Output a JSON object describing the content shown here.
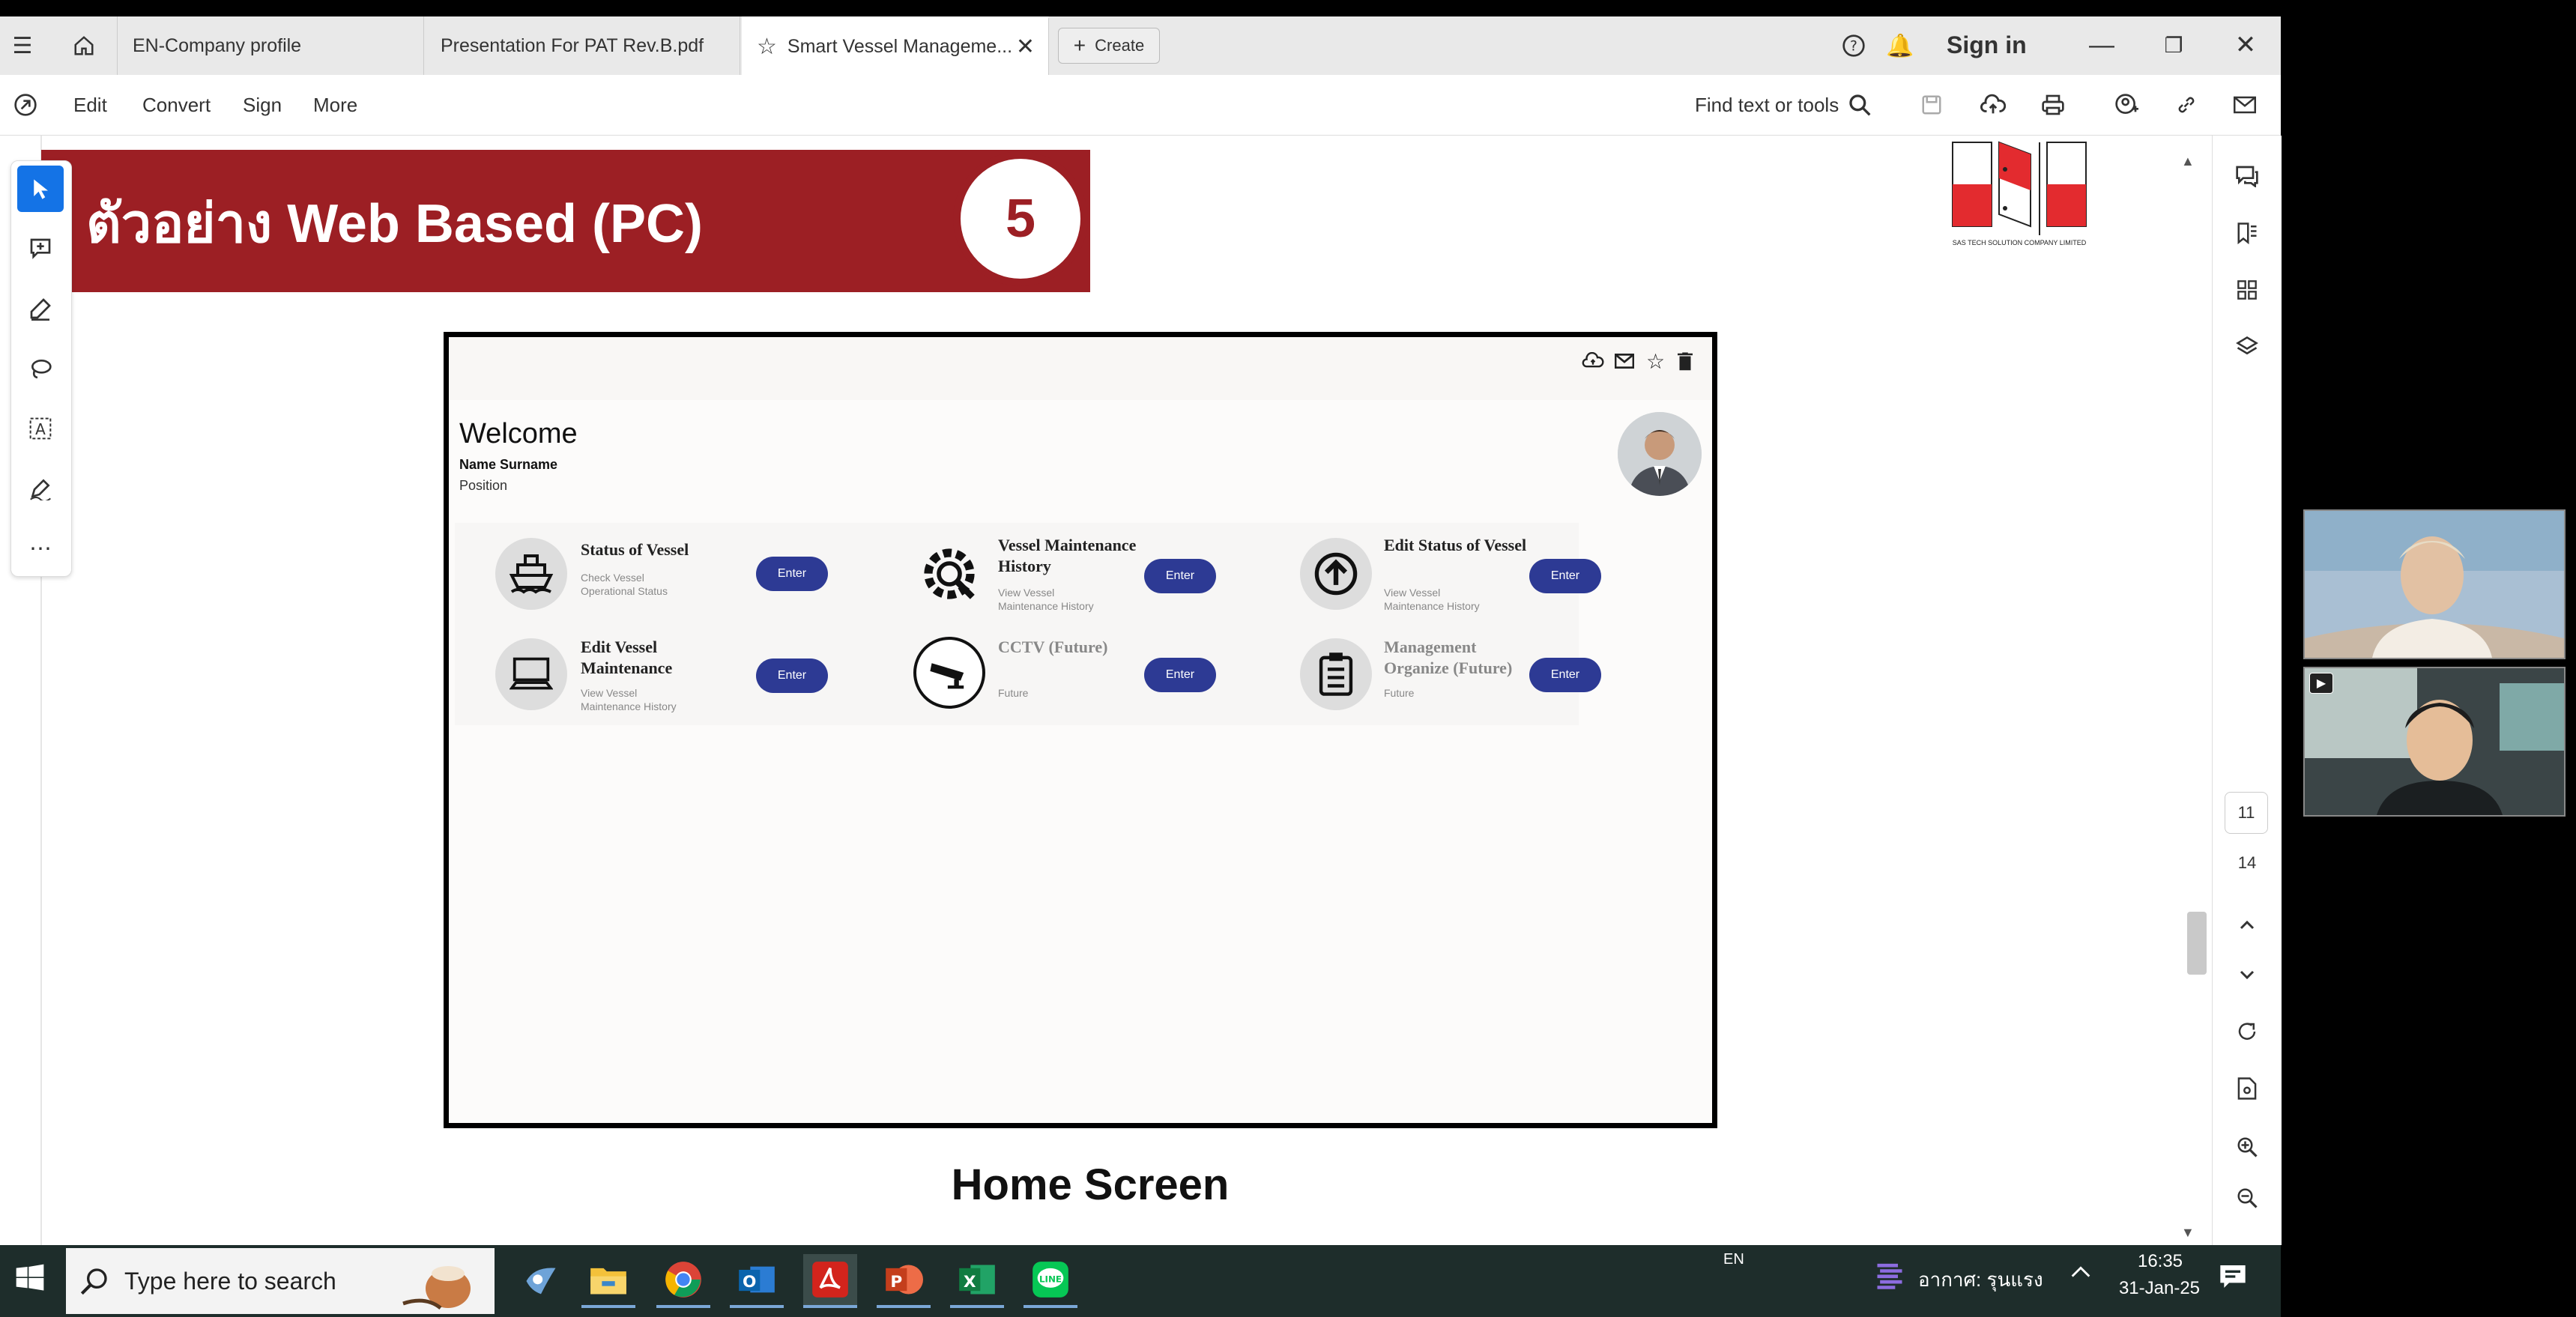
{
  "browser_tabs": [
    {
      "label": "EN-Company profile"
    },
    {
      "label": "Presentation For PAT Rev.B.pdf"
    },
    {
      "label": "Smart Vessel Manageme..."
    }
  ],
  "create_label": "Create",
  "signin_label": "Sign in",
  "menu": {
    "edit": "Edit",
    "convert": "Convert",
    "sign": "Sign",
    "more": "More"
  },
  "find_label": "Find text or tools",
  "page_nav": {
    "current": "11",
    "total": "14"
  },
  "slide": {
    "banner_title": "ตัวอย่าง Web Based (PC)",
    "slide_number": "5",
    "logo_caption": "SAS TECH SOLUTION COMPANY LIMITED",
    "caption": "Home Screen"
  },
  "mockup": {
    "welcome": "Welcome",
    "name": "Name Surname",
    "position": "Position",
    "enter_label": "Enter",
    "cards": [
      {
        "title": "Status of Vessel",
        "sub1": "Check Vessel",
        "sub2": "Operational Status",
        "icon": "ship-icon"
      },
      {
        "title": "Vessel Maintenance History",
        "sub1": "View Vessel",
        "sub2": "Maintenance History",
        "icon": "wrench-gear-icon"
      },
      {
        "title": "Edit Status of Vessel",
        "sub1": "View Vessel",
        "sub2": "Maintenance History",
        "icon": "upload-circle-icon"
      },
      {
        "title": "Edit Vessel Maintenance",
        "sub1": "View Vessel",
        "sub2": "Maintenance History",
        "icon": "computer-icon"
      },
      {
        "title": "CCTV (Future)",
        "sub1": "Future",
        "sub2": "",
        "icon": "cctv-icon"
      },
      {
        "title": "Management Organize (Future)",
        "sub1": "Future",
        "sub2": "",
        "icon": "clipboard-icon"
      }
    ]
  },
  "taskbar": {
    "search_placeholder": "Type here to search",
    "lang": "EN",
    "weather": "อากาศ: รุนแรง",
    "time": "16:35",
    "date": "31-Jan-25"
  },
  "colors": {
    "banner": "#9c1f24",
    "enter_button": "#2d3a94",
    "acrobat_blue": "#1473e6"
  }
}
